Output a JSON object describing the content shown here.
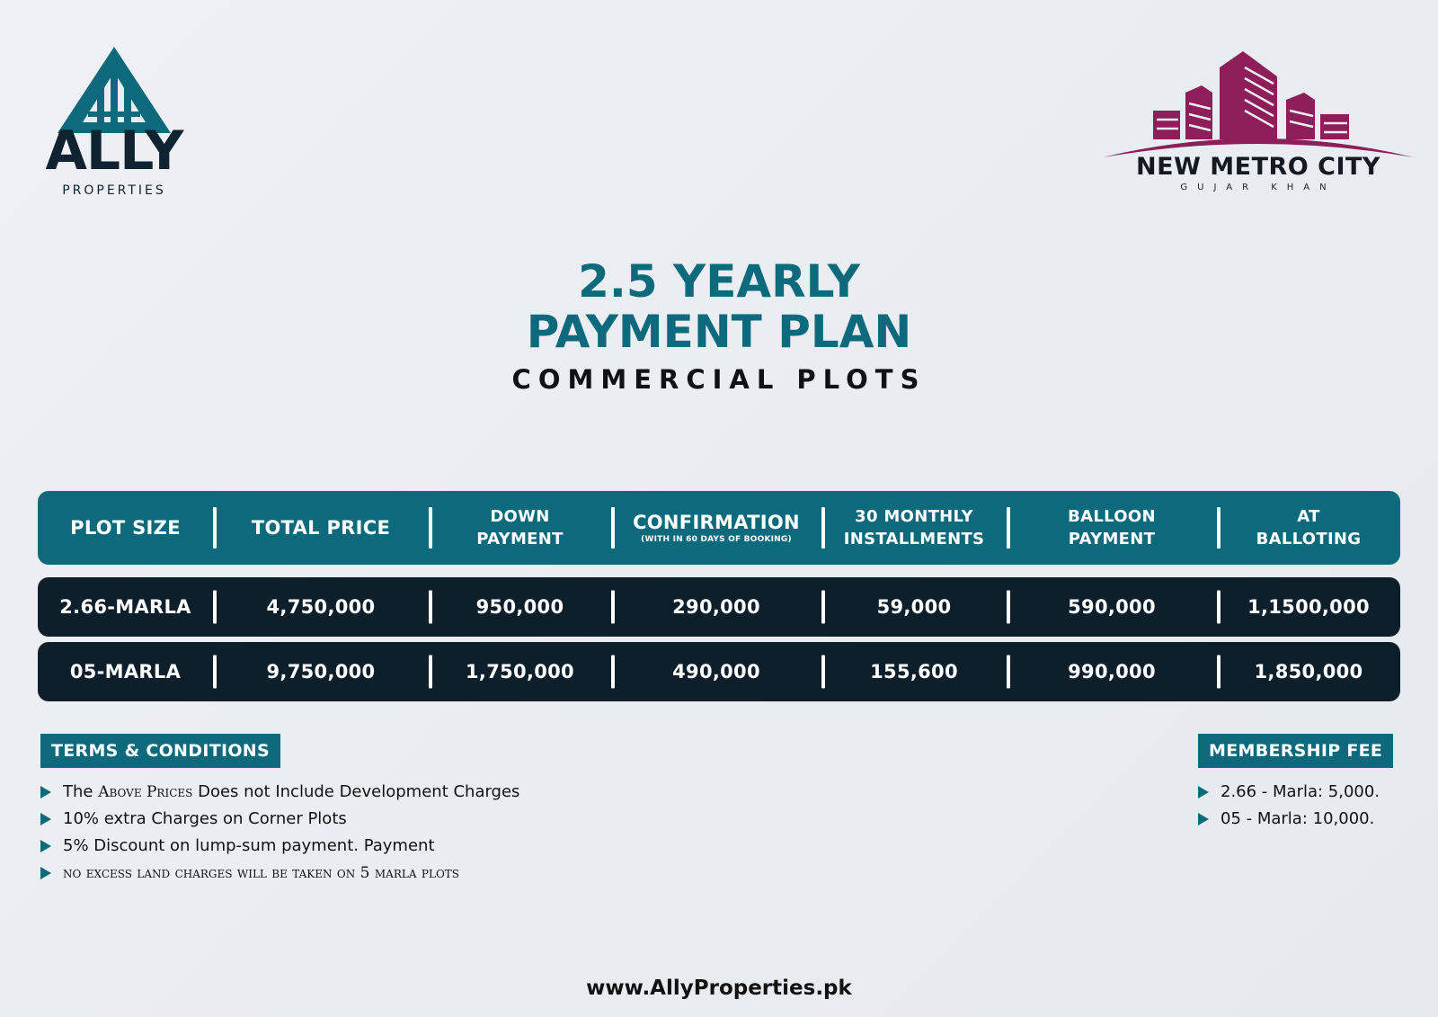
{
  "logos": {
    "ally": {
      "name": "ALLY",
      "sub": "PROPERTIES",
      "color": "#0d6a7d"
    },
    "metro": {
      "name": "NEW METRO CITY",
      "sub": "GUJAR KHAN",
      "color": "#8e1e5a"
    }
  },
  "heading": {
    "line1": "2.5 YEARLY",
    "line2": "PAYMENT PLAN",
    "sub": "COMMERCIAL PLOTS"
  },
  "table": {
    "headers": [
      {
        "label": "PLOT SIZE"
      },
      {
        "label": "TOTAL PRICE"
      },
      {
        "line1": "DOWN",
        "line2": "PAYMENT"
      },
      {
        "line1": "CONFIRMATION",
        "note": "(WITH IN 60 DAYS OF BOOKING)"
      },
      {
        "line1": "30 MONTHLY",
        "line2": "INSTALLMENTS"
      },
      {
        "line1": "BALLOON",
        "line2": "PAYMENT"
      },
      {
        "line1": "AT",
        "line2": "BALLOTING"
      }
    ],
    "rows": [
      [
        "2.66-MARLA",
        "4,750,000",
        "950,000",
        "290,000",
        "59,000",
        "590,000",
        "1,1500,000"
      ],
      [
        "05-MARLA",
        "9,750,000",
        "1,750,000",
        "490,000",
        "155,600",
        "990,000",
        "1,850,000"
      ]
    ]
  },
  "terms": {
    "title": "TERMS & CONDITIONS",
    "items": [
      {
        "pre": "The ",
        "caps": "Above Prices",
        "post": " Does not Include Development Charges"
      },
      {
        "text": "10% extra Charges on Corner Plots"
      },
      {
        "text": "5% Discount on lump-sum payment. Payment"
      },
      {
        "caps": "no excess land charges will be taken on 5 marla plots"
      }
    ]
  },
  "membership": {
    "title": "MEMBERSHIP FEE",
    "items": [
      "2.66 - Marla: 5,000.",
      "05 - Marla: 10,000."
    ]
  },
  "footer": {
    "url": "www.AllyProperties.pk"
  }
}
